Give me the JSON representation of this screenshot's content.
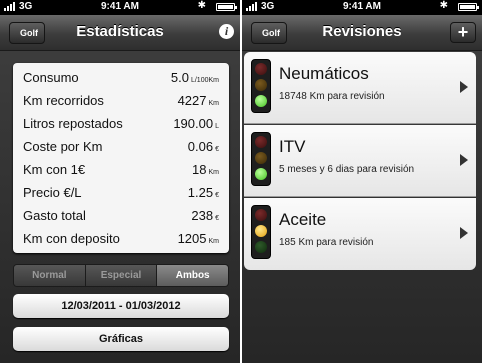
{
  "status_bar": {
    "left": {
      "carrier": "3G",
      "time": "9:41 AM"
    },
    "right": {
      "carrier": "3G",
      "time": "9:41 AM"
    }
  },
  "left_screen": {
    "nav": {
      "back_label": "Golf",
      "title": "Estadísticas",
      "info_icon": "info-icon"
    },
    "stats": [
      {
        "label": "Consumo",
        "value": "5.0",
        "unit": "L/100Km"
      },
      {
        "label": "Km recorridos",
        "value": "4227",
        "unit": "Km"
      },
      {
        "label": "Litros repostados",
        "value": "190.00",
        "unit": "L"
      },
      {
        "label": "Coste por Km",
        "value": "0.06",
        "unit": "€"
      },
      {
        "label": "Km con 1€",
        "value": "18",
        "unit": "Km"
      },
      {
        "label": "Precio €/L",
        "value": "1.25",
        "unit": "€"
      },
      {
        "label": "Gasto total",
        "value": "238",
        "unit": "€"
      },
      {
        "label": "Km con deposito",
        "value": "1205",
        "unit": "Km"
      }
    ],
    "segments": [
      "Normal",
      "Especial",
      "Ambos"
    ],
    "selected_segment": "Ambos",
    "date_range": "12/03/2011 - 01/03/2012",
    "charts_button": "Gráficas"
  },
  "right_screen": {
    "nav": {
      "back_label": "Golf",
      "title": "Revisiones",
      "add_icon": "plus-icon"
    },
    "items": [
      {
        "title": "Neumáticos",
        "subtitle": "18748 Km para revisión",
        "light": "green"
      },
      {
        "title": "ITV",
        "subtitle": "5 meses y 6 dias para revisión",
        "light": "green"
      },
      {
        "title": "Aceite",
        "subtitle": "185 Km para revisión",
        "light": "amber"
      }
    ]
  },
  "colors": {
    "background": "#2e2e2e",
    "card": "#f5f5f5",
    "light_green": "#45c322",
    "light_amber": "#e3a112",
    "light_red": "#c51d12"
  }
}
